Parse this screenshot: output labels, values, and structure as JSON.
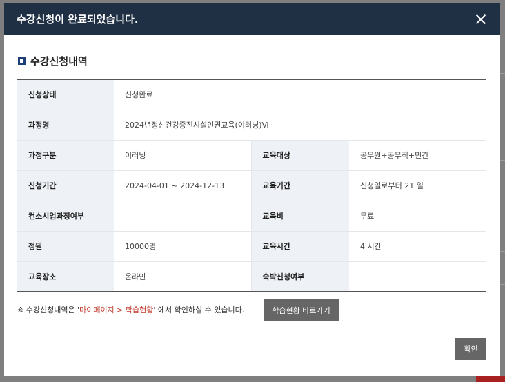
{
  "modal": {
    "title": "수강신청이 완료되었습니다.",
    "close_icon": "close-icon"
  },
  "section": {
    "title": "수강신청내역"
  },
  "details": {
    "status_label": "신청상태",
    "status_value": "신청완료",
    "course_name_label": "과정명",
    "course_name_value": "2024년정신건강증진시설인권교육(이러닝)Ⅵ",
    "course_type_label": "과정구분",
    "course_type_value": "이러닝",
    "target_label": "교육대상",
    "target_value": "공무원+공무직+민간",
    "apply_period_label": "신청기간",
    "apply_period_value": "2024-04-01 ~ 2024-12-13",
    "edu_period_label": "교육기간",
    "edu_period_value": "신청일로부터 21 일",
    "consortium_label": "컨소시엄과정여부",
    "consortium_value": "",
    "fee_label": "교육비",
    "fee_value": "무료",
    "capacity_label": "정원",
    "capacity_value": "10000명",
    "hours_label": "교육시간",
    "hours_value": "4 시간",
    "place_label": "교육장소",
    "place_value": "온라인",
    "lodging_label": "숙박신청여부",
    "lodging_value": ""
  },
  "note": {
    "prefix": "※ 수강신청내역은 '",
    "highlight": "마이페이지 > 학습현황",
    "suffix": "' 에서 확인하실 수 있습니다."
  },
  "buttons": {
    "shortcut": "학습현황 바로가기",
    "confirm": "확인"
  }
}
